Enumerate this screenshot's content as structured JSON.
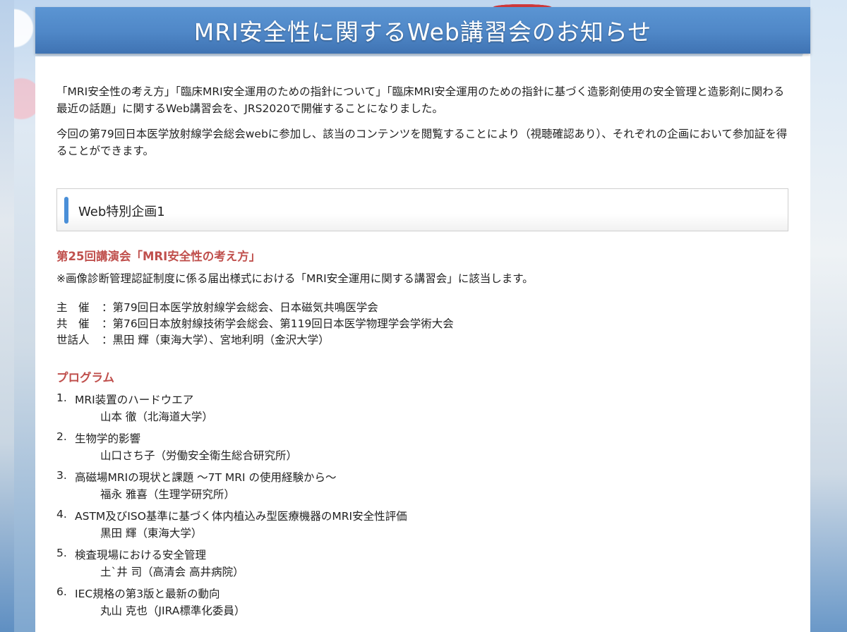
{
  "header": {
    "title": "MRI安全性に関するWeb講習会のお知らせ"
  },
  "intro": {
    "paragraph1": "「MRI安全性の考え方」「臨床MRI安全運用のための指針について」「臨床MRI安全運用のための指針に基づく造影剤使用の安全管理と造影剤に関わる最近の話題」に関するWeb講習会を、JRS2020で開催することになりました。",
    "paragraph2": "今回の第79回日本医学放射線学会総会webに参加し、該当のコンテンツを閲覧することにより（視聴確認あり）、それぞれの企画において参加証を得ることができます。"
  },
  "section": {
    "label": "Web特別企画1"
  },
  "lecture": {
    "title": "第25回講演会「MRI安全性の考え方」",
    "note": "※画像診断管理認証制度に係る届出様式における「MRI安全運用に関する講習会」に該当します。"
  },
  "organizers": [
    {
      "role": "主　催",
      "value": "：第79回日本医学放射線学会総会、日本磁気共鳴医学会"
    },
    {
      "role": "共　催",
      "value": "：第76回日本放射線技術学会総会、第119回日本医学物理学会学術大会"
    },
    {
      "role": "世話人",
      "value": "：黒田 輝（東海大学）、宮地利明（金沢大学）"
    }
  ],
  "program": {
    "heading": "プログラム",
    "items": [
      {
        "num": "1.",
        "title": "MRI装置のハードウエア",
        "speaker": "山本 徹（北海道大学）"
      },
      {
        "num": "2.",
        "title": "生物学的影響",
        "speaker": "山口さち子（労働安全衛生総合研究所）"
      },
      {
        "num": "3.",
        "title": "高磁場MRIの現状と課題 ～7T MRI の使用経験から～",
        "speaker": "福永 雅喜（生理学研究所）"
      },
      {
        "num": "4.",
        "title": "ASTM及びISO基準に基づく体内植込み型医療機器のMRI安全性評価",
        "speaker": "黒田 輝（東海大学）"
      },
      {
        "num": "5.",
        "title": "検査現場における安全管理",
        "speaker": "土`井 司（高清会 高井病院）"
      },
      {
        "num": "6.",
        "title": "IEC規格の第3版と最新の動向",
        "speaker": "丸山 克也（JIRA標準化委員）"
      }
    ]
  },
  "colors": {
    "header_blue": "#4f87c7",
    "accent_blue": "#4a8fd8",
    "heading_red": "#c0504d"
  }
}
